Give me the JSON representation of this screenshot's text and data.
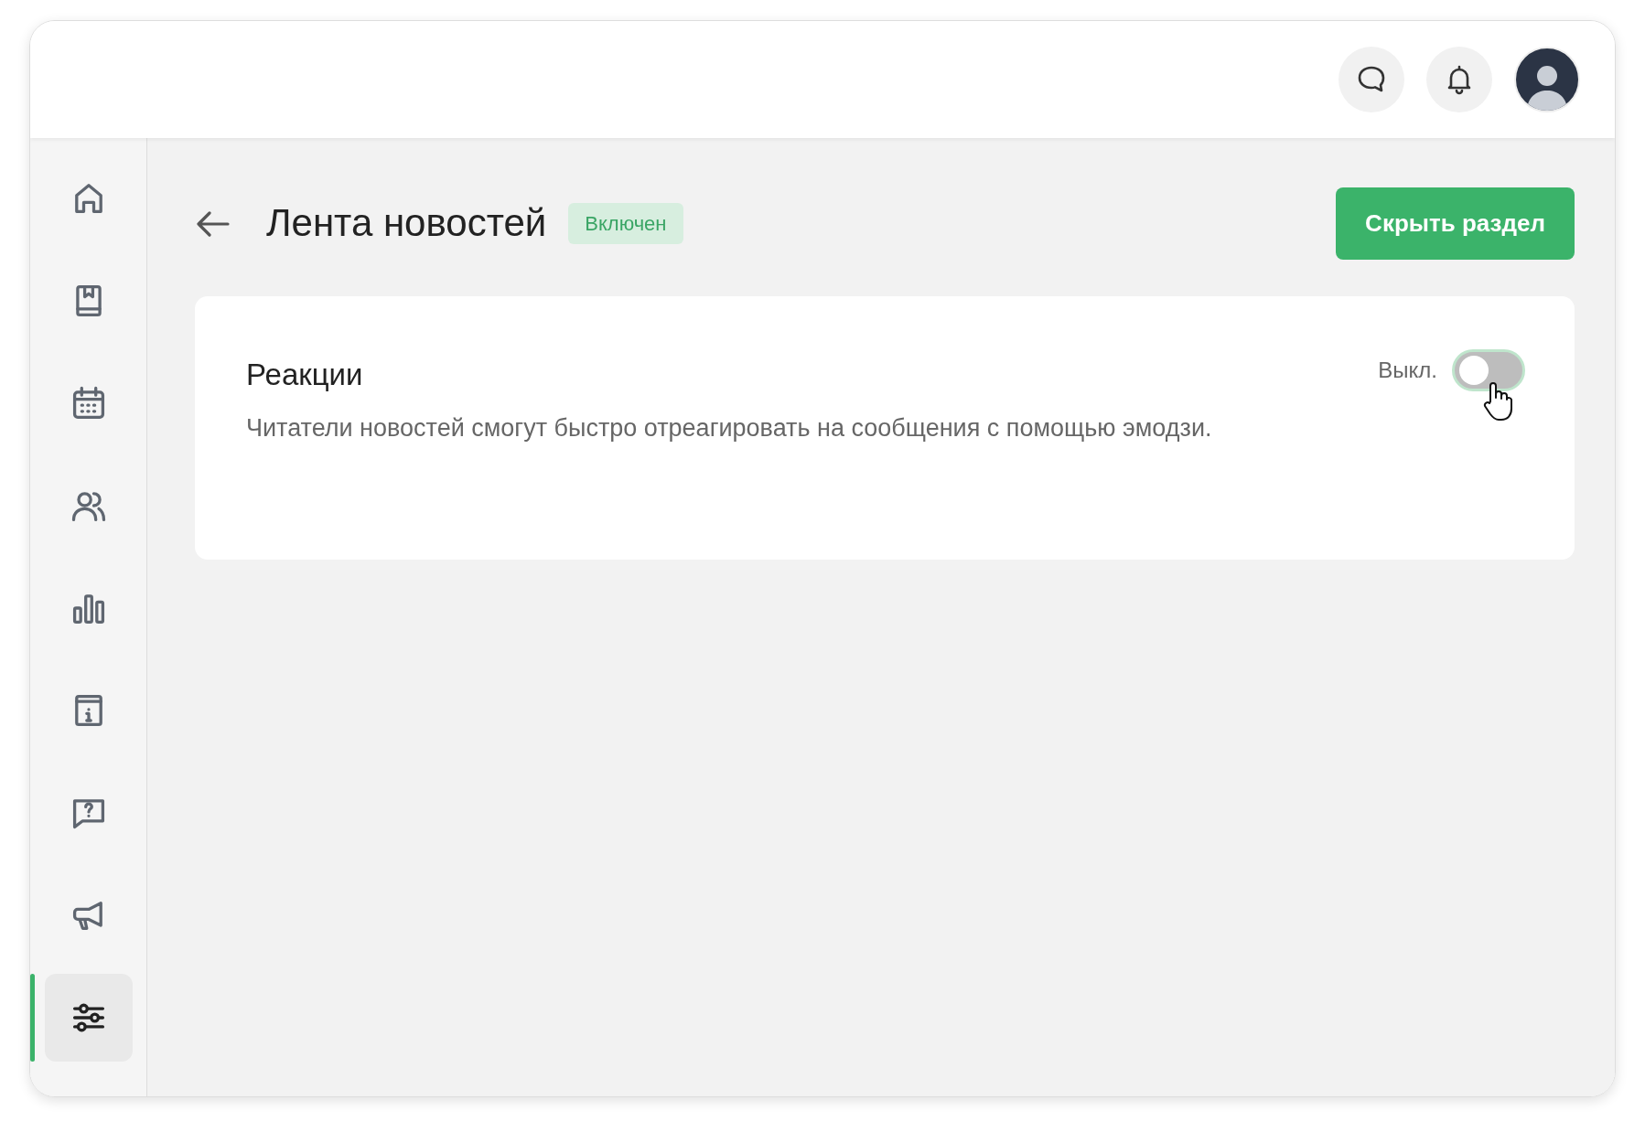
{
  "sidebar": {
    "items": [
      {
        "selected": false
      },
      {
        "selected": false
      },
      {
        "selected": false
      },
      {
        "selected": false
      },
      {
        "selected": false
      },
      {
        "selected": false
      },
      {
        "selected": false
      },
      {
        "selected": false
      },
      {
        "selected": true
      }
    ]
  },
  "page": {
    "title": "Лента новостей",
    "status": "Включен",
    "action": "Скрыть раздел"
  },
  "settings": [
    {
      "title": "Реакции",
      "description": "Читатели новостей смогут быстро отреагировать на сообщения с помощью эмодзи.",
      "toggle_label": "Выкл.",
      "on": false
    }
  ]
}
